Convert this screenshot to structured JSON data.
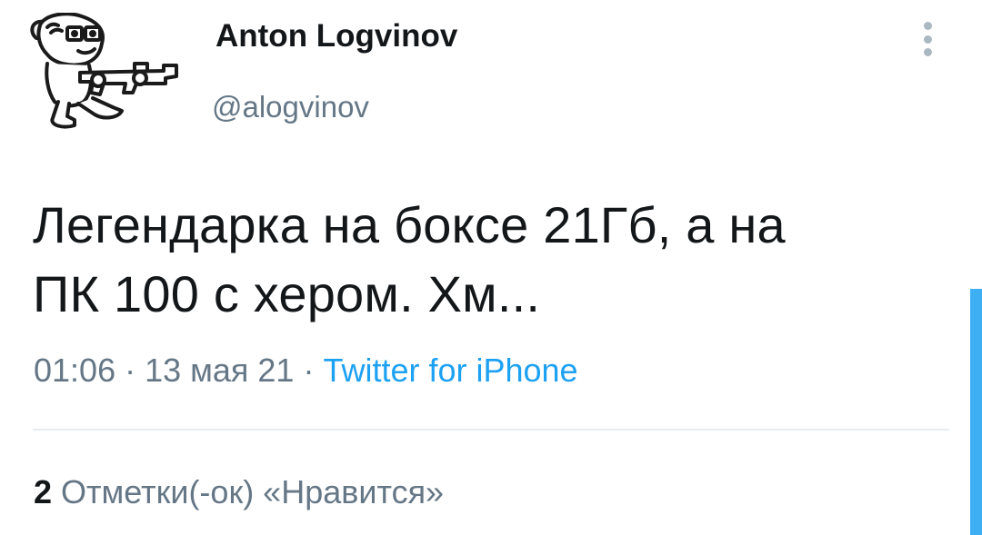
{
  "author": {
    "display_name": "Anton Logvinov",
    "handle": "@alogvinov"
  },
  "tweet": {
    "text_line1": "Легендарка на боксе 21Гб, а на",
    "text_line2": "ПК 100 с хером. Хм...",
    "time": "01:06",
    "separator": " · ",
    "date": "13 мая 21",
    "source": "Twitter for iPhone"
  },
  "engagement": {
    "likes_count": "2",
    "likes_label": "Отметки(-ок) «Нравится»"
  },
  "icons": {
    "avatar": "avatar-illustration",
    "more": "more-options-vertical-dots-icon"
  },
  "colors": {
    "text": "#14171a",
    "secondary": "#657786",
    "accent": "#1da1f2",
    "divider": "#e6ecf0"
  }
}
